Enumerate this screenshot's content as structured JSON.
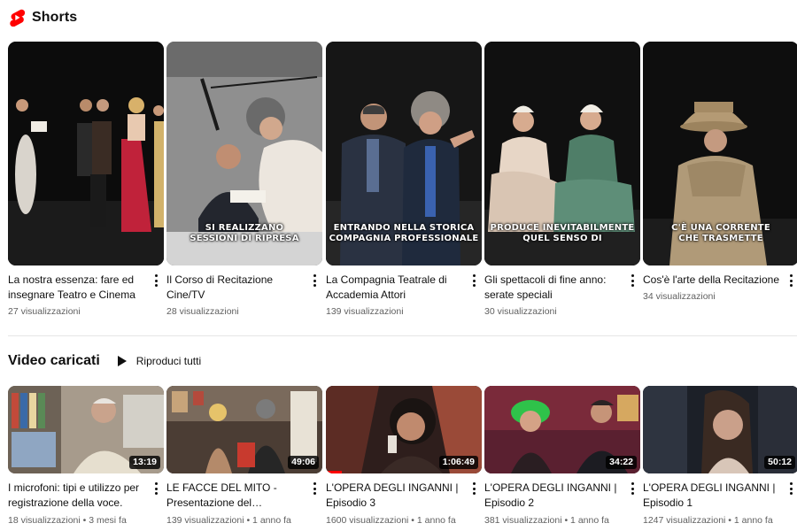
{
  "shorts": {
    "title": "Shorts",
    "logo_icon": "youtube-shorts-icon",
    "items": [
      {
        "title": "La nostra essenza: fare ed insegnare Teatro e Cinema",
        "views": "27 visualizzazioni",
        "caption": ""
      },
      {
        "title": "Il Corso di Recitazione Cine/TV",
        "views": "28 visualizzazioni",
        "caption": "SI REALIZZANO\nSESSIONI DI RIPRESA"
      },
      {
        "title": "La Compagnia Teatrale di Accademia Attori",
        "views": "139 visualizzazioni",
        "caption": "ENTRANDO NELLA STORICA\nCOMPAGNIA PROFESSIONALE"
      },
      {
        "title": "Gli spettacoli di fine anno: serate speciali",
        "views": "30 visualizzazioni",
        "caption": "PRODUCE INEVITABILMENTE\nQUEL SENSO DI"
      },
      {
        "title": "Cos'è l'arte della Recitazione",
        "views": "34 visualizzazioni",
        "caption": "C'È UNA CORRENTE\nCHE TRASMETTE"
      }
    ]
  },
  "uploads": {
    "title": "Video caricati",
    "play_all_label": "Riproduci tutti",
    "items": [
      {
        "title": "I microfoni: tipi e utilizzo per registrazione della voce.",
        "duration": "13:19",
        "meta": "18 visualizzazioni • 3 mesi fa"
      },
      {
        "title": "LE FACCE DEL MITO - Presentazione del…",
        "duration": "49:06",
        "meta": "139 visualizzazioni • 1 anno fa"
      },
      {
        "title": "L'OPERA DEGLI INGANNI | Episodio 3",
        "duration": "1:06:49",
        "meta": "1600 visualizzazioni • 1 anno fa",
        "watched_fraction": 0.1
      },
      {
        "title": "L'OPERA DEGLI INGANNI | Episodio 2",
        "duration": "34:22",
        "meta": "381 visualizzazioni • 1 anno fa"
      },
      {
        "title": "L'OPERA DEGLI INGANNI | Episodio 1",
        "duration": "50:12",
        "meta": "1247 visualizzazioni • 1 anno fa"
      }
    ]
  },
  "colors": {
    "brand_red": "#ff0000",
    "text_primary": "#0f0f0f",
    "text_secondary": "#606060"
  }
}
